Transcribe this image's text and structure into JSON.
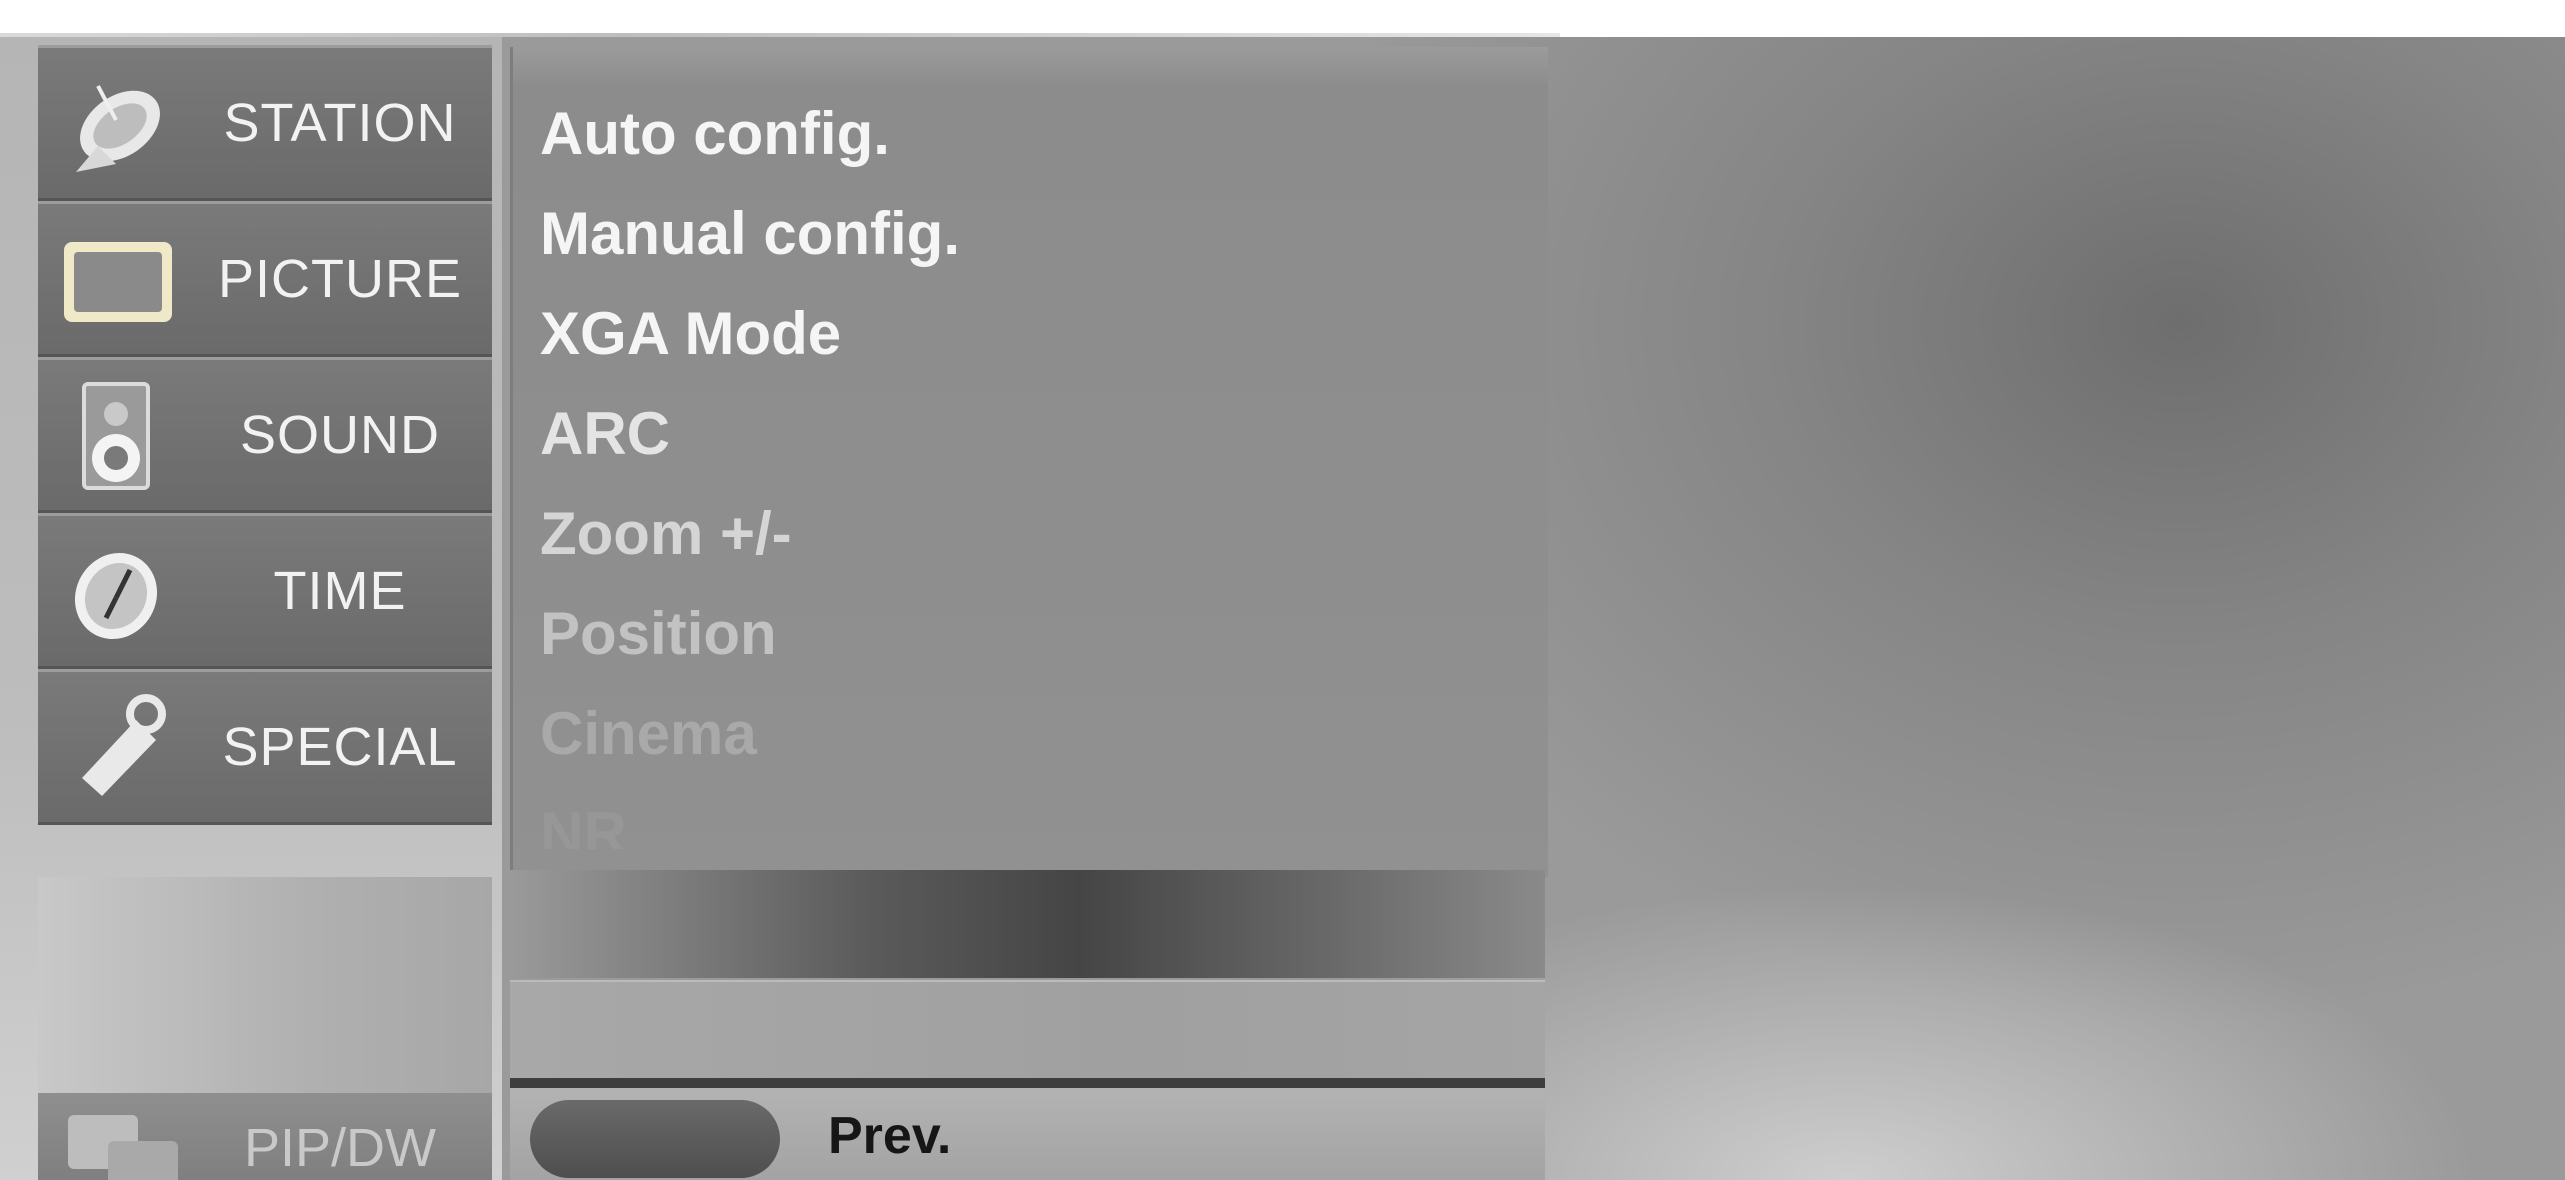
{
  "sidebar": {
    "items": [
      {
        "label": "STATION",
        "icon": "satellite-dish-icon"
      },
      {
        "label": "PICTURE",
        "icon": "tv-screen-icon"
      },
      {
        "label": "SOUND",
        "icon": "speaker-icon"
      },
      {
        "label": "TIME",
        "icon": "clock-icon"
      },
      {
        "label": "SPECIAL",
        "icon": "tag-icon"
      }
    ],
    "pip": {
      "label": "PIP/DW",
      "icon": "pip-window-icon"
    }
  },
  "menu": {
    "items": [
      {
        "label": "Auto config."
      },
      {
        "label": "Manual config."
      },
      {
        "label": "XGA Mode"
      },
      {
        "label": "ARC"
      },
      {
        "label": "Zoom +/-"
      },
      {
        "label": "Position"
      },
      {
        "label": "Cinema"
      },
      {
        "label": "NR"
      }
    ]
  },
  "footer": {
    "prev_label": "Prev."
  },
  "colors": {
    "menu_text": "#f5f5f5",
    "sidebar_item": "#6e6e6e",
    "prev_button": "#555555"
  }
}
